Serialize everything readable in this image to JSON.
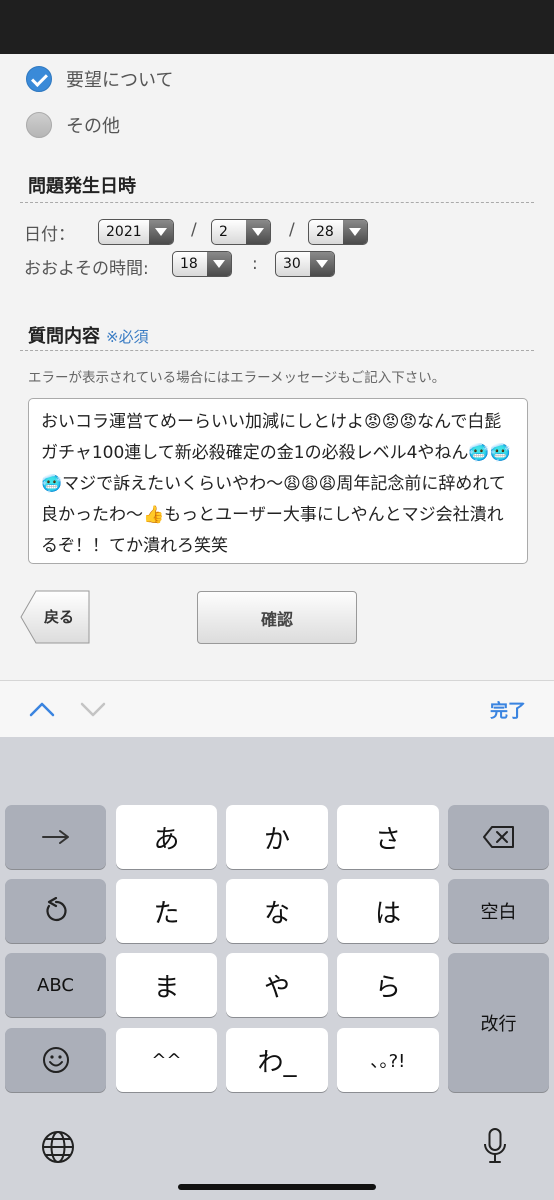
{
  "radios": [
    {
      "label": "要望について",
      "checked": true
    },
    {
      "label": "その他",
      "checked": false
    }
  ],
  "datetime_section": {
    "title": "問題発生日時",
    "date_label": "日付：",
    "time_label": "おおよその時間:",
    "year": "2021",
    "month": "2",
    "day": "28",
    "hour": "18",
    "minute": "30",
    "date_sep": "/",
    "time_sep": ":"
  },
  "question_section": {
    "title": "質問内容",
    "required": "※必須",
    "hint": "エラーが表示されている場合にはエラーメッセージもご記入下さい。",
    "text": "おいコラ運営てめーらいい加減にしとけよ😡😡😡なんで白髭ガチャ100連して新必殺確定の金1の必殺レベル4やねん🥶🥶🥶マジで訴えたいくらいやわ〜😩😩😩周年記念前に辞めれて良かったわ〜👍もっとユーザー大事にしやんとマジ会社潰れるぞ！！てか潰れろ笑笑"
  },
  "buttons": {
    "back": "戻る",
    "confirm": "確認"
  },
  "accessory": {
    "done": "完了"
  },
  "keyboard": {
    "row1": [
      "→",
      "あ",
      "か",
      "さ",
      "⌫"
    ],
    "row2": [
      "↺",
      "た",
      "な",
      "は",
      "空白"
    ],
    "row3": [
      "ABC",
      "ま",
      "や",
      "ら",
      "改行"
    ],
    "row4": [
      "☺",
      "^^",
      "わ",
      "､｡?!"
    ],
    "wa_label": "わ_"
  },
  "colors": {
    "accent": "#3a84e0",
    "required": "#3a7cc4",
    "checkbox": "#3a8ad8"
  }
}
